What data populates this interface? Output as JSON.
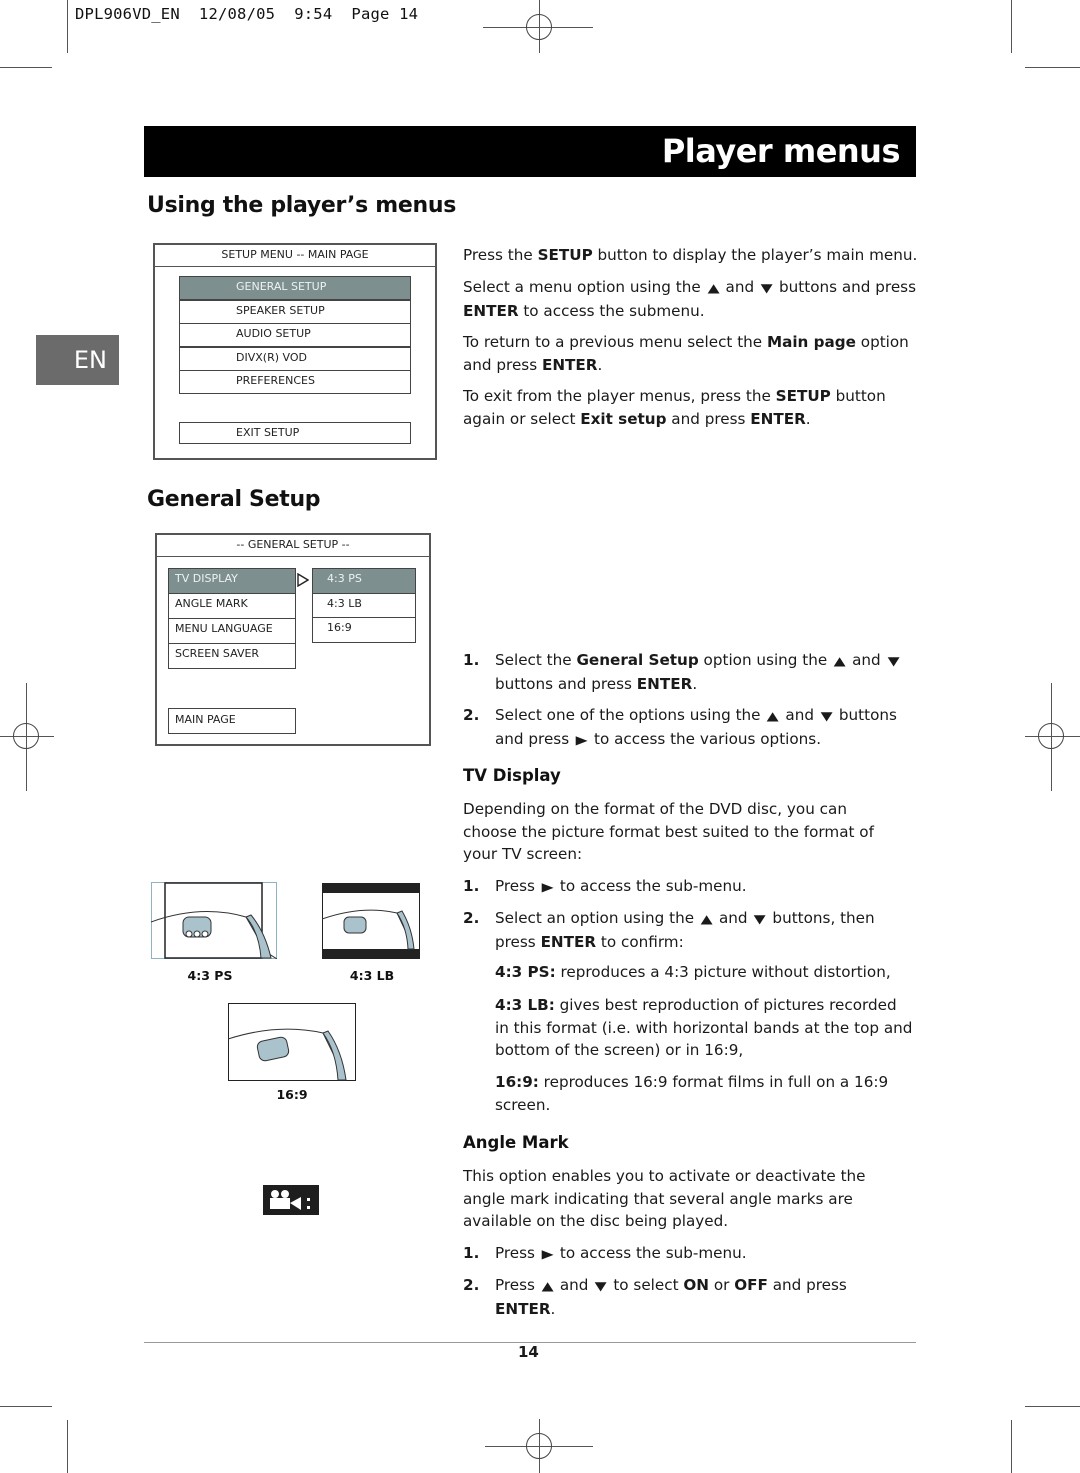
{
  "slug": "DPL906VD_EN  12/08/05  9:54  Page 14",
  "header": {
    "title": "Player menus"
  },
  "language_tab": "EN",
  "section1": {
    "heading": "Using the player’s menus",
    "osd": {
      "title": "SETUP MENU -- MAIN PAGE",
      "items": [
        "GENERAL SETUP",
        "SPEAKER SETUP",
        "AUDIO SETUP",
        "DIVX(R) VOD",
        "PREFERENCES"
      ],
      "selected_index": 0,
      "exit": "EXIT SETUP"
    },
    "paragraphs": [
      {
        "parts": [
          "Press the ",
          {
            "b": "SETUP"
          },
          " button to display the player’s main menu."
        ]
      },
      {
        "parts": [
          "Select a menu option using the ",
          {
            "icon": "up"
          },
          " and ",
          {
            "icon": "down"
          },
          " buttons and press ",
          {
            "b": "ENTER"
          },
          " to access the submenu."
        ]
      },
      {
        "parts": [
          "To return to a previous menu select the ",
          {
            "b": "Main page"
          },
          " option and press ",
          {
            "b": "ENTER"
          },
          "."
        ]
      },
      {
        "parts": [
          "To exit from the player menus, press the ",
          {
            "b": "SETUP"
          },
          " button again or select ",
          {
            "b": "Exit setup"
          },
          " and press ",
          {
            "b": "ENTER"
          },
          "."
        ]
      }
    ]
  },
  "section2": {
    "heading": "General Setup",
    "osd": {
      "title": "-- GENERAL SETUP --",
      "items": [
        "TV DISPLAY",
        "ANGLE MARK",
        "MENU LANGUAGE",
        "SCREEN SAVER"
      ],
      "selected_index": 0,
      "sub_items": [
        "4:3 PS",
        "4:3 LB",
        "16:9"
      ],
      "sub_selected_index": 0,
      "main_page": "MAIN PAGE"
    },
    "steps": [
      {
        "num": "1.",
        "parts": [
          "Select the ",
          {
            "b": "General Setup"
          },
          " option using the ",
          {
            "icon": "up"
          },
          " and ",
          {
            "icon": "down"
          },
          " buttons and press ",
          {
            "b": "ENTER"
          },
          "."
        ]
      },
      {
        "num": "2.",
        "parts": [
          "Select one of the options using the ",
          {
            "icon": "up"
          },
          " and ",
          {
            "icon": "down"
          },
          " buttons and press ",
          {
            "icon": "right"
          },
          " to access the various options."
        ]
      }
    ]
  },
  "tv_display": {
    "heading": "TV Display",
    "intro": "Depending on the format of the DVD disc, you can choose the picture format best suited to the format of your TV screen:",
    "steps": [
      {
        "num": "1.",
        "parts": [
          "Press ",
          {
            "icon": "right"
          },
          " to access the sub-menu."
        ]
      },
      {
        "num": "2.",
        "parts": [
          "Select an option using the ",
          {
            "icon": "up"
          },
          " and ",
          {
            "icon": "down"
          },
          " buttons, then press ",
          {
            "b": "ENTER"
          },
          " to confirm:"
        ]
      }
    ],
    "options": [
      {
        "label": "4:3 PS:",
        "text": " reproduces a 4:3 picture without distortion,"
      },
      {
        "label": "4:3 LB:",
        "text": " gives best reproduction of pictures recorded in this format (i.e. with horizontal bands at the top and bottom of the screen) or in 16:9,"
      },
      {
        "label": "16:9:",
        "text": " reproduces 16:9 format films in full on a 16:9 screen."
      }
    ],
    "captions": [
      "4:3 PS",
      "4:3 LB",
      "16:9"
    ]
  },
  "angle_mark": {
    "heading": "Angle Mark",
    "intro": "This option enables you to activate or deactivate the angle mark indicating that several angle marks are available on the disc being played.",
    "steps": [
      {
        "num": "1.",
        "parts": [
          "Press ",
          {
            "icon": "right"
          },
          " to access the sub-menu."
        ]
      },
      {
        "num": "2.",
        "parts": [
          "Press ",
          {
            "icon": "up"
          },
          " and ",
          {
            "icon": "down"
          },
          " to select ",
          {
            "b": "ON"
          },
          " or ",
          {
            "b": "OFF"
          },
          " and press ",
          {
            "b": "ENTER"
          },
          "."
        ]
      }
    ],
    "icon": "camera-angle-icon"
  },
  "footer": {
    "page_number": "14"
  }
}
